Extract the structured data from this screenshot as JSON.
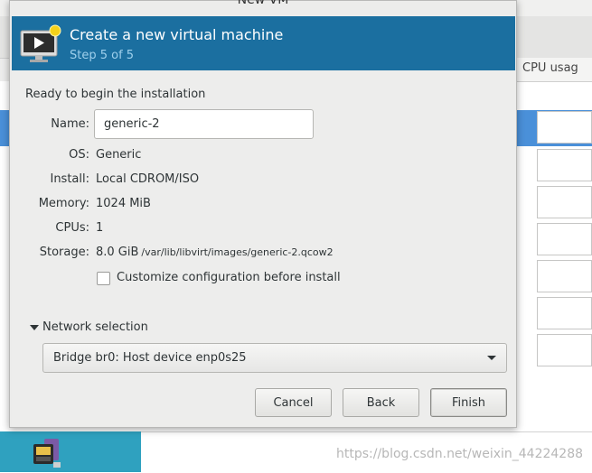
{
  "window_title": "New VM",
  "banner": {
    "title": "Create a new virtual machine",
    "step": "Step 5 of 5",
    "icon": "monitor-new-icon"
  },
  "summary": {
    "heading": "Ready to begin the installation",
    "name_label": "Name:",
    "name_value": "generic-2",
    "os_label": "OS:",
    "os_value": "Generic",
    "install_label": "Install:",
    "install_value": "Local CDROM/ISO",
    "memory_label": "Memory:",
    "memory_value": "1024 MiB",
    "cpus_label": "CPUs:",
    "cpus_value": "1",
    "storage_label": "Storage:",
    "storage_value": "8.0 GiB",
    "storage_path": "/var/lib/libvirt/images/generic-2.qcow2"
  },
  "customize": {
    "label": "Customize configuration before install",
    "checked": false
  },
  "network": {
    "expander_label": "Network selection",
    "expanded": true,
    "selected": "Bridge br0: Host device enp0s25"
  },
  "buttons": {
    "cancel": "Cancel",
    "back": "Back",
    "finish": "Finish"
  },
  "background": {
    "column_header": "CPU usag"
  },
  "watermark": "https://blog.csdn.net/weixin_44224288",
  "colors": {
    "banner": "#1b6fa0",
    "selection": "#4a90d9",
    "taskbar_tile": "#2fa1bf"
  }
}
